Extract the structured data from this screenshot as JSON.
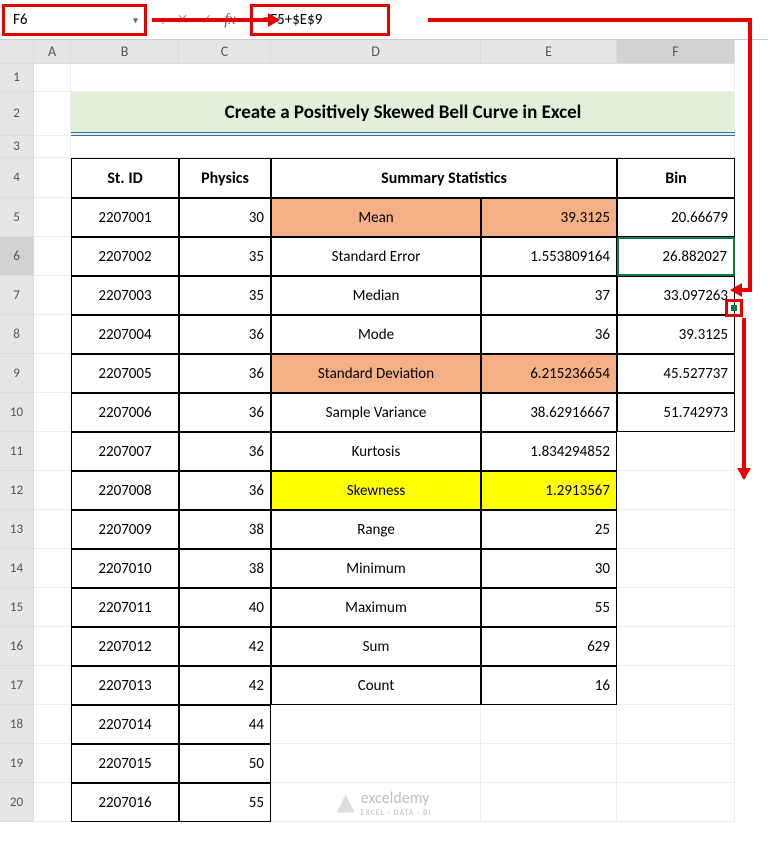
{
  "name_box": "F6",
  "formula": "=F5+$E$9",
  "columns": [
    "A",
    "B",
    "C",
    "D",
    "E",
    "F"
  ],
  "title": "Create a Positively Skewed Bell Curve in Excel",
  "headers": {
    "stid": "St. ID",
    "physics": "Physics",
    "summary": "Summary Statistics",
    "bin": "Bin"
  },
  "rows": [
    {
      "id": "2207001",
      "ph": "30",
      "stat": "Mean",
      "val": "39.3125",
      "bin": "20.66679",
      "hl": "orange"
    },
    {
      "id": "2207002",
      "ph": "35",
      "stat": "Standard Error",
      "val": "1.553809164",
      "bin": "26.882027",
      "sel": true
    },
    {
      "id": "2207003",
      "ph": "35",
      "stat": "Median",
      "val": "37",
      "bin": "33.097263"
    },
    {
      "id": "2207004",
      "ph": "36",
      "stat": "Mode",
      "val": "36",
      "bin": "39.3125"
    },
    {
      "id": "2207005",
      "ph": "36",
      "stat": "Standard Deviation",
      "val": "6.215236654",
      "bin": "45.527737",
      "hl": "orange"
    },
    {
      "id": "2207006",
      "ph": "36",
      "stat": "Sample Variance",
      "val": "38.62916667",
      "bin": "51.742973"
    },
    {
      "id": "2207007",
      "ph": "36",
      "stat": "Kurtosis",
      "val": "1.834294852"
    },
    {
      "id": "2207008",
      "ph": "36",
      "stat": "Skewness",
      "val": "1.2913567",
      "hl": "yellow"
    },
    {
      "id": "2207009",
      "ph": "38",
      "stat": "Range",
      "val": "25"
    },
    {
      "id": "2207010",
      "ph": "38",
      "stat": "Minimum",
      "val": "30"
    },
    {
      "id": "2207011",
      "ph": "40",
      "stat": "Maximum",
      "val": "55"
    },
    {
      "id": "2207012",
      "ph": "42",
      "stat": "Sum",
      "val": "629"
    },
    {
      "id": "2207013",
      "ph": "42",
      "stat": "Count",
      "val": "16"
    },
    {
      "id": "2207014",
      "ph": "44"
    },
    {
      "id": "2207015",
      "ph": "50"
    },
    {
      "id": "2207016",
      "ph": "55"
    }
  ],
  "watermark": {
    "name": "exceldemy",
    "sub": "EXCEL · DATA · BI"
  }
}
